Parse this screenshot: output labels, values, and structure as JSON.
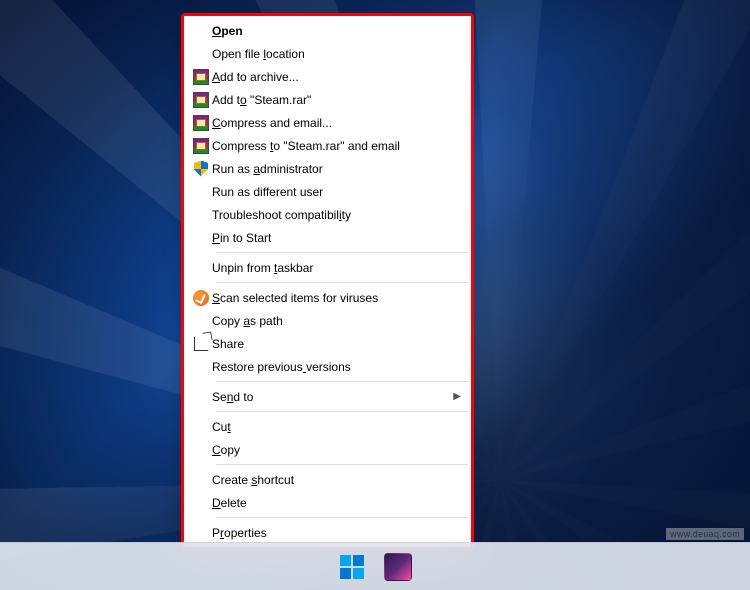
{
  "context_menu": {
    "groups": [
      [
        {
          "id": "open",
          "label": "Open",
          "underline": 0,
          "bold": true,
          "icon": null,
          "arrow": false
        },
        {
          "id": "open-file-location",
          "label": "Open file location",
          "underline": 10,
          "icon": null,
          "arrow": false
        },
        {
          "id": "add-to-archive",
          "label": "Add to archive...",
          "underline": 0,
          "icon": "winrar",
          "arrow": false
        },
        {
          "id": "add-to-steam-rar",
          "label": "Add to \"Steam.rar\"",
          "underline": 5,
          "icon": "winrar",
          "arrow": false
        },
        {
          "id": "compress-and-email",
          "label": "Compress and email...",
          "underline": 0,
          "icon": "winrar",
          "arrow": false
        },
        {
          "id": "compress-to-steam-email",
          "label": "Compress to \"Steam.rar\" and email",
          "underline": 9,
          "icon": "winrar",
          "arrow": false
        },
        {
          "id": "run-as-admin",
          "label": "Run as administrator",
          "underline": 7,
          "icon": "shield",
          "arrow": false
        },
        {
          "id": "run-as-different-user",
          "label": "Run as different user",
          "underline": null,
          "icon": null,
          "arrow": false
        },
        {
          "id": "troubleshoot",
          "label": "Troubleshoot compatibility",
          "underline": 23,
          "icon": null,
          "arrow": false
        },
        {
          "id": "pin-to-start",
          "label": "Pin to Start",
          "underline": 0,
          "icon": null,
          "arrow": false
        }
      ],
      [
        {
          "id": "unpin-taskbar",
          "label": "Unpin from taskbar",
          "underline": 11,
          "icon": null,
          "arrow": false
        }
      ],
      [
        {
          "id": "scan-viruses",
          "label": "Scan selected items for viruses",
          "underline": 0,
          "icon": "av",
          "arrow": false
        },
        {
          "id": "copy-as-path",
          "label": "Copy as path",
          "underline": 5,
          "icon": null,
          "arrow": false
        },
        {
          "id": "share",
          "label": "Share",
          "underline": null,
          "icon": "share",
          "arrow": false
        },
        {
          "id": "restore-versions",
          "label": "Restore previous versions",
          "underline": 16,
          "icon": null,
          "arrow": false
        }
      ],
      [
        {
          "id": "send-to",
          "label": "Send to",
          "underline": 2,
          "icon": null,
          "arrow": true
        }
      ],
      [
        {
          "id": "cut",
          "label": "Cut",
          "underline": 2,
          "icon": null,
          "arrow": false
        },
        {
          "id": "copy",
          "label": "Copy",
          "underline": 0,
          "icon": null,
          "arrow": false
        }
      ],
      [
        {
          "id": "create-shortcut",
          "label": "Create shortcut",
          "underline": 7,
          "icon": null,
          "arrow": false
        },
        {
          "id": "delete",
          "label": "Delete",
          "underline": 0,
          "icon": null,
          "arrow": false
        }
      ],
      [
        {
          "id": "properties",
          "label": "Properties",
          "underline": 1,
          "icon": null,
          "arrow": false
        }
      ]
    ]
  },
  "taskbar": {
    "items": [
      "start",
      "pinned-app"
    ]
  },
  "watermark": "www.deuaq.com"
}
